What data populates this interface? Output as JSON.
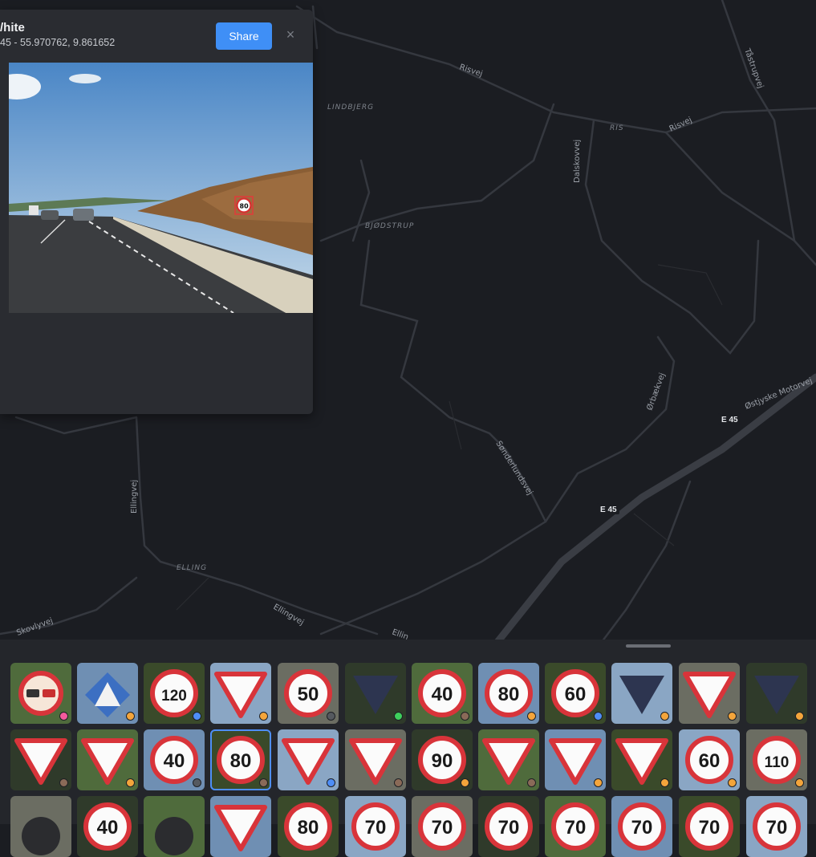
{
  "card": {
    "title": "/hite",
    "coords": "45 - 55.970762, 9.861652",
    "share_label": "Share",
    "close_glyph": "×",
    "sign_value": "80"
  },
  "map": {
    "roads": [
      "Risvej",
      "Risvej",
      "Tåstrupvej",
      "Dalskovvej",
      "Ørbækvej",
      "Sønderlundsvej",
      "Østjyske Motorvej",
      "Ellingvej",
      "Ellingvej",
      "Ellingvej",
      "Ellin",
      "Skovlyvej"
    ],
    "places": [
      "LINDBJERG",
      "RIS",
      "BJØDSTRUP",
      "ELLING"
    ],
    "shields": [
      "E 45",
      "E 45"
    ]
  },
  "thumbnails": {
    "rows": [
      [
        {
          "kind": "no-overtaking",
          "status": "#f45a9d"
        },
        {
          "kind": "pedestrian",
          "status": "#f4a53b"
        },
        {
          "kind": "speed",
          "value": "120",
          "status": "#4e8ef7"
        },
        {
          "kind": "yield",
          "status": "#f4a53b"
        },
        {
          "kind": "speed",
          "value": "50",
          "status": "#55595f"
        },
        {
          "kind": "yield-dark",
          "status": "#3ecf5c"
        },
        {
          "kind": "speed",
          "value": "40",
          "status": "#8a6a58"
        },
        {
          "kind": "speed",
          "value": "80",
          "status": "#f4a53b"
        },
        {
          "kind": "speed",
          "value": "60",
          "status": "#4e8ef7"
        },
        {
          "kind": "yield-dark",
          "status": "#f4a53b"
        },
        {
          "kind": "yield",
          "status": "#f4a53b"
        },
        {
          "kind": "yield-dark",
          "status": "#f4a53b"
        }
      ],
      [
        {
          "kind": "yield",
          "status": "#8a6a58"
        },
        {
          "kind": "yield",
          "status": "#f4a53b"
        },
        {
          "kind": "speed",
          "value": "40",
          "status": "#55595f"
        },
        {
          "kind": "speed",
          "value": "80",
          "status": "#8a6a58",
          "selected": true
        },
        {
          "kind": "yield",
          "status": "#4e8ef7"
        },
        {
          "kind": "yield",
          "status": "#8a6a58"
        },
        {
          "kind": "speed",
          "value": "90",
          "status": "#f4a53b"
        },
        {
          "kind": "yield",
          "status": "#8a6a58"
        },
        {
          "kind": "yield",
          "status": "#f4a53b"
        },
        {
          "kind": "yield",
          "status": "#f4a53b"
        },
        {
          "kind": "speed",
          "value": "60",
          "status": "#f4a53b"
        },
        {
          "kind": "speed",
          "value": "110",
          "status": "#f4a53b"
        }
      ],
      [
        {
          "kind": "dark"
        },
        {
          "kind": "speed",
          "value": "40"
        },
        {
          "kind": "dark"
        },
        {
          "kind": "yield"
        },
        {
          "kind": "speed",
          "value": "80"
        },
        {
          "kind": "speed",
          "value": "70"
        },
        {
          "kind": "speed",
          "value": "70"
        },
        {
          "kind": "speed",
          "value": "70"
        },
        {
          "kind": "speed",
          "value": "70"
        },
        {
          "kind": "speed",
          "value": "70"
        },
        {
          "kind": "speed",
          "value": "70"
        },
        {
          "kind": "speed",
          "value": "70"
        }
      ]
    ]
  }
}
